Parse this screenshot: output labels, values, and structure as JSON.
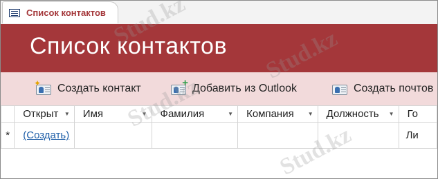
{
  "tab": {
    "icon": "form-icon",
    "label": "Список контактов"
  },
  "header": {
    "title": "Список контактов"
  },
  "toolbar": {
    "create_contact": "Создать контакт",
    "add_from_outlook": "Добавить из Outlook",
    "create_email": "Создать почтов"
  },
  "table": {
    "columns": [
      "Открыт",
      "Имя",
      "Фамилия",
      "Компания",
      "Должность",
      "Го"
    ],
    "new_row": {
      "marker": "*",
      "open_link": "(Создать)",
      "last_cell": "Ли"
    }
  },
  "watermark": {
    "text": "Stud.kz"
  },
  "colors": {
    "accent": "#a4373a",
    "toolbar_bg": "#f2dadb",
    "link": "#1f5fa8"
  }
}
